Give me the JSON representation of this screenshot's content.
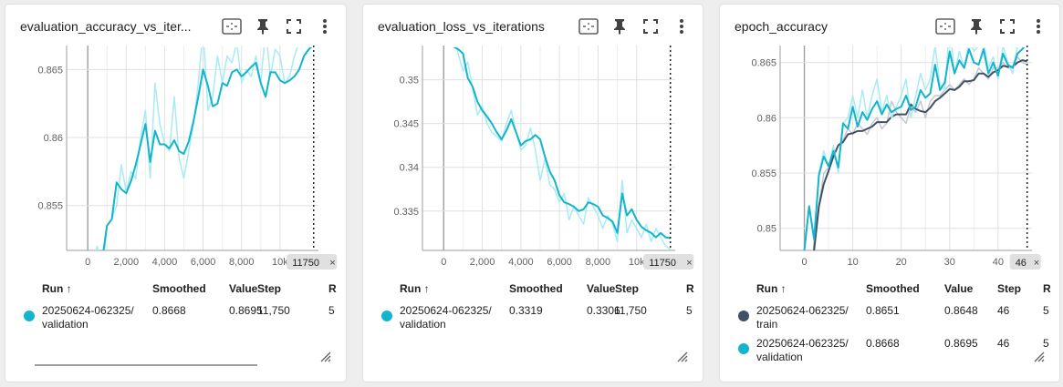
{
  "colors": {
    "validation": "#12b5cb",
    "validation_raw": "#a8ebf3",
    "train": "#425066",
    "train_raw": "#c4c8d0"
  },
  "table_headers": {
    "run": "Run ↑",
    "smoothed": "Smoothed",
    "value": "Value",
    "step": "Step",
    "extra": "R"
  },
  "cards": [
    {
      "title": "evaluation_accuracy_vs_iter...",
      "icons": [
        "fit-domain-icon",
        "pin-icon",
        "fullscreen-icon",
        "more-vert-icon"
      ],
      "step_marker_label": "11750",
      "rows": [
        {
          "run_line1": "20250624-062325/",
          "run_line2": "validation",
          "smoothed": "0.8668",
          "value": "0.8695",
          "step": "11,750",
          "extra": "5"
        }
      ]
    },
    {
      "title": "evaluation_loss_vs_iterations",
      "icons": [
        "fit-domain-icon",
        "pin-icon",
        "fullscreen-icon",
        "more-vert-icon"
      ],
      "step_marker_label": "11750",
      "rows": [
        {
          "run_line1": "20250624-062325/",
          "run_line2": "validation",
          "smoothed": "0.3319",
          "value": "0.3306",
          "step": "11,750",
          "extra": "5"
        }
      ]
    },
    {
      "title": "epoch_accuracy",
      "icons": [
        "fit-domain-icon",
        "pin-icon",
        "fullscreen-icon",
        "more-vert-icon"
      ],
      "step_marker_label": "46",
      "rows": [
        {
          "run_line1": "20250624-062325/",
          "run_line2": "train",
          "smoothed": "0.8651",
          "value": "0.8648",
          "step": "46",
          "extra": "5"
        },
        {
          "run_line1": "20250624-062325/",
          "run_line2": "validation",
          "smoothed": "0.8668",
          "value": "0.8695",
          "step": "46",
          "extra": "5"
        }
      ]
    }
  ],
  "chart_data": [
    {
      "type": "line",
      "xlim": [
        -1100,
        12000
      ],
      "ylim": [
        0.8517,
        0.8665
      ],
      "x_ticks": [
        0,
        2000,
        4000,
        6000,
        8000,
        10000
      ],
      "x_tick_labels": [
        "0",
        "2,000",
        "4,000",
        "6,000",
        "8,000",
        "10k"
      ],
      "y_ticks": [
        0.855,
        0.86,
        0.865
      ],
      "y_tick_labels": [
        "0.855",
        "0.86",
        "0.865"
      ],
      "step_marker": 11750,
      "series": [
        {
          "x": [
            250,
            500,
            750,
            1000,
            1250,
            1500,
            1750,
            2000,
            2250,
            2500,
            2750,
            3000,
            3250,
            3500,
            3750,
            4000,
            4250,
            4500,
            4750,
            5000,
            5250,
            5500,
            5750,
            6000,
            6250,
            6500,
            6750,
            7000,
            7250,
            7500,
            7750,
            8000,
            8250,
            8500,
            8750,
            9000,
            9250,
            9500,
            9750,
            10000,
            10250,
            10500,
            10750,
            11000,
            11250,
            11500,
            11750
          ],
          "raw": [
            0.851,
            0.852,
            0.85,
            0.8535,
            0.854,
            0.855,
            0.858,
            0.856,
            0.8575,
            0.857,
            0.86,
            0.862,
            0.857,
            0.864,
            0.861,
            0.8595,
            0.859,
            0.863,
            0.8585,
            0.857,
            0.859,
            0.861,
            0.864,
            0.868,
            0.862,
            0.863,
            0.866,
            0.864,
            0.866,
            0.8655,
            0.867,
            0.864,
            0.865,
            0.8645,
            0.866,
            0.864,
            0.868,
            0.8645,
            0.8665,
            0.866,
            0.864,
            0.8645,
            0.866,
            0.867,
            0.868,
            0.8685,
            0.8695
          ],
          "smoothed": [
            0.8511,
            0.8512,
            0.851,
            0.8535,
            0.854,
            0.8567,
            0.8562,
            0.8559,
            0.8568,
            0.858,
            0.8595,
            0.861,
            0.8582,
            0.8605,
            0.8595,
            0.8595,
            0.8592,
            0.8598,
            0.859,
            0.8588,
            0.8597,
            0.8612,
            0.863,
            0.865,
            0.8638,
            0.8623,
            0.8625,
            0.864,
            0.8638,
            0.8648,
            0.865,
            0.8645,
            0.8648,
            0.8652,
            0.8655,
            0.864,
            0.863,
            0.8648,
            0.8648,
            0.8642,
            0.864,
            0.8642,
            0.8645,
            0.865,
            0.866,
            0.8665,
            0.8668
          ]
        }
      ]
    },
    {
      "type": "line",
      "xlim": [
        -1100,
        12000
      ],
      "ylim": [
        0.3305,
        0.3535
      ],
      "x_ticks": [
        0,
        2000,
        4000,
        6000,
        8000,
        10000
      ],
      "x_tick_labels": [
        "0",
        "2,000",
        "4,000",
        "6,000",
        "8,000",
        "10k"
      ],
      "y_ticks": [
        0.335,
        0.34,
        0.345,
        0.35
      ],
      "y_tick_labels": [
        "0.335",
        "0.34",
        "0.345",
        "0.35"
      ],
      "step_marker": 11750,
      "series": [
        {
          "x": [
            500,
            750,
            1000,
            1250,
            1500,
            1750,
            2000,
            2250,
            2500,
            2750,
            3000,
            3250,
            3500,
            3750,
            4000,
            4250,
            4500,
            4750,
            5000,
            5250,
            5500,
            5750,
            6000,
            6250,
            6500,
            6750,
            7000,
            7250,
            7500,
            7750,
            8000,
            8250,
            8500,
            8750,
            9000,
            9250,
            9500,
            9750,
            10000,
            10250,
            10500,
            10750,
            11000,
            11250,
            11500,
            11750
          ],
          "raw": [
            0.355,
            0.353,
            0.351,
            0.352,
            0.349,
            0.346,
            0.347,
            0.345,
            0.344,
            0.3435,
            0.343,
            0.345,
            0.3465,
            0.344,
            0.342,
            0.3425,
            0.3445,
            0.342,
            0.3385,
            0.341,
            0.338,
            0.3375,
            0.336,
            0.337,
            0.334,
            0.3355,
            0.3345,
            0.3335,
            0.3365,
            0.3355,
            0.3345,
            0.333,
            0.3345,
            0.3335,
            0.3315,
            0.3385,
            0.3325,
            0.334,
            0.333,
            0.332,
            0.3335,
            0.3315,
            0.333,
            0.332,
            0.331,
            0.3306
          ],
          "smoothed": [
            0.3538,
            0.3535,
            0.353,
            0.3502,
            0.3492,
            0.3475,
            0.3465,
            0.3458,
            0.345,
            0.344,
            0.3432,
            0.3442,
            0.3455,
            0.344,
            0.3425,
            0.343,
            0.3432,
            0.3437,
            0.3432,
            0.3412,
            0.3395,
            0.3385,
            0.3368,
            0.336,
            0.3358,
            0.3355,
            0.335,
            0.3352,
            0.336,
            0.3358,
            0.3355,
            0.3345,
            0.3342,
            0.3338,
            0.3325,
            0.337,
            0.3345,
            0.3352,
            0.334,
            0.3332,
            0.3328,
            0.3325,
            0.332,
            0.3325,
            0.332,
            0.3319
          ]
        }
      ]
    },
    {
      "type": "line",
      "xlim": [
        -5,
        47
      ],
      "ylim": [
        0.848,
        0.8662
      ],
      "x_ticks": [
        0,
        10,
        20,
        30,
        40
      ],
      "x_tick_labels": [
        "0",
        "10",
        "20",
        "30",
        "40"
      ],
      "y_ticks": [
        0.85,
        0.855,
        0.86,
        0.865
      ],
      "y_tick_labels": [
        "0.85",
        "0.855",
        "0.86",
        "0.865"
      ],
      "step_marker": 46,
      "series": [
        {
          "name": "train",
          "x": [
            0,
            1,
            2,
            3,
            4,
            5,
            6,
            7,
            8,
            9,
            10,
            11,
            12,
            13,
            14,
            15,
            16,
            17,
            18,
            19,
            20,
            21,
            22,
            23,
            24,
            25,
            26,
            27,
            28,
            29,
            30,
            31,
            32,
            33,
            34,
            35,
            36,
            37,
            38,
            39,
            40,
            41,
            42,
            43,
            44,
            45,
            46
          ],
          "raw": [
            0.836,
            0.843,
            0.849,
            0.852,
            0.855,
            0.8555,
            0.8565,
            0.8575,
            0.858,
            0.859,
            0.8585,
            0.8595,
            0.859,
            0.8585,
            0.8595,
            0.86,
            0.859,
            0.8595,
            0.8615,
            0.8605,
            0.86,
            0.8595,
            0.861,
            0.8605,
            0.8615,
            0.86,
            0.8615,
            0.862,
            0.862,
            0.8625,
            0.863,
            0.8625,
            0.863,
            0.8635,
            0.863,
            0.8635,
            0.8645,
            0.864,
            0.8635,
            0.8645,
            0.8645,
            0.865,
            0.8645,
            0.8645,
            0.8655,
            0.865,
            0.8648
          ],
          "smoothed": [
            0.8365,
            0.843,
            0.848,
            0.852,
            0.854,
            0.8552,
            0.8565,
            0.8575,
            0.8578,
            0.8585,
            0.8586,
            0.8588,
            0.8588,
            0.859,
            0.8592,
            0.8596,
            0.8596,
            0.8596,
            0.8601,
            0.8603,
            0.8603,
            0.8603,
            0.8612,
            0.8608,
            0.8606,
            0.8605,
            0.8609,
            0.8615,
            0.8618,
            0.8622,
            0.8626,
            0.8625,
            0.8628,
            0.8633,
            0.8633,
            0.8634,
            0.864,
            0.864,
            0.8637,
            0.8641,
            0.8643,
            0.8647,
            0.8646,
            0.8646,
            0.865,
            0.8652,
            0.8651
          ]
        },
        {
          "name": "validation",
          "x": [
            0,
            1,
            2,
            3,
            4,
            5,
            6,
            7,
            8,
            9,
            10,
            11,
            12,
            13,
            14,
            15,
            16,
            17,
            18,
            19,
            20,
            21,
            22,
            23,
            24,
            25,
            26,
            27,
            28,
            29,
            30,
            31,
            32,
            33,
            34,
            35,
            36,
            37,
            38,
            39,
            40,
            41,
            42,
            43,
            44,
            45,
            46
          ],
          "raw": [
            0.848,
            0.852,
            0.849,
            0.855,
            0.857,
            0.8555,
            0.8575,
            0.855,
            0.8595,
            0.86,
            0.862,
            0.86,
            0.8625,
            0.86,
            0.862,
            0.8635,
            0.8605,
            0.862,
            0.86,
            0.861,
            0.862,
            0.8635,
            0.86,
            0.862,
            0.864,
            0.8625,
            0.8635,
            0.8665,
            0.863,
            0.8625,
            0.8685,
            0.864,
            0.866,
            0.8645,
            0.867,
            0.866,
            0.8665,
            0.867,
            0.8645,
            0.8655,
            0.8635,
            0.8665,
            0.865,
            0.864,
            0.8665,
            0.8675,
            0.8695
          ],
          "smoothed": [
            0.848,
            0.852,
            0.849,
            0.8548,
            0.8565,
            0.8556,
            0.857,
            0.8555,
            0.8595,
            0.859,
            0.861,
            0.8592,
            0.8605,
            0.8598,
            0.8608,
            0.8615,
            0.8603,
            0.8612,
            0.8605,
            0.8608,
            0.861,
            0.862,
            0.8607,
            0.861,
            0.8625,
            0.8618,
            0.8622,
            0.8648,
            0.8625,
            0.8632,
            0.866,
            0.864,
            0.8652,
            0.8645,
            0.8662,
            0.865,
            0.8648,
            0.8662,
            0.864,
            0.865,
            0.8638,
            0.8658,
            0.8648,
            0.8645,
            0.8658,
            0.8662,
            0.8668
          ]
        }
      ]
    }
  ]
}
